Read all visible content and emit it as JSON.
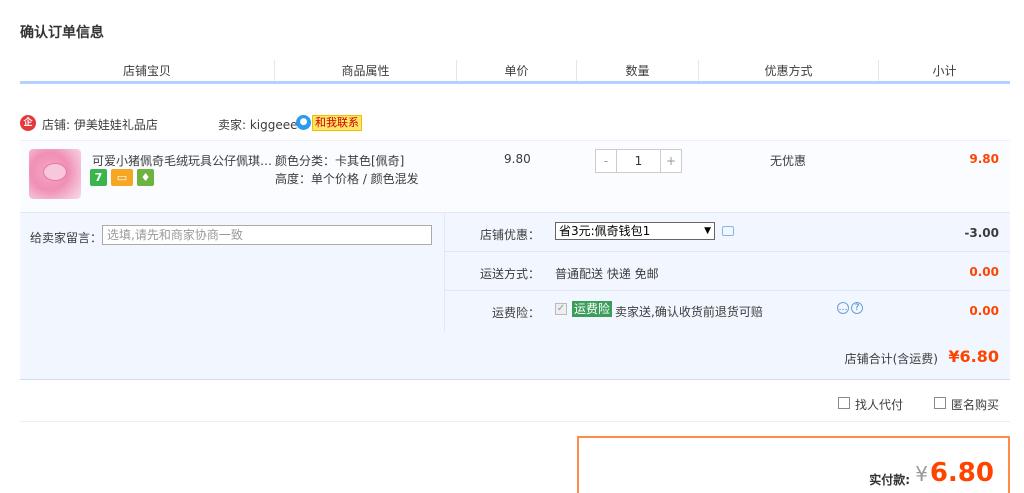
{
  "page": {
    "title": "确认订单信息"
  },
  "columns": [
    "店铺宝贝",
    "商品属性",
    "单价",
    "数量",
    "优惠方式",
    "小计"
  ],
  "shop": {
    "icon": "shop-badge-icon",
    "name": "店铺: 伊美娃娃礼品店",
    "seller": "卖家: kiggeee",
    "contact_label": "和我联系"
  },
  "item": {
    "title": "可爱小猪佩奇毛绒玩具公仔佩琪乔治",
    "badges": [
      {
        "name": "seven-day-return-icon",
        "text": "7"
      },
      {
        "name": "credit-card-icon",
        "text": ""
      },
      {
        "name": "safe-guarantee-icon",
        "text": ""
      }
    ],
    "attr_color": "颜色分类：卡其色[佩奇]",
    "attr_height": "高度：单个价格 / 颜色混发",
    "unit_price": "9.80",
    "qty_minus": "-",
    "quantity": "1",
    "qty_plus": "+",
    "discount": "无优惠",
    "subtotal": "9.80"
  },
  "extras": {
    "message_label": "给卖家留言：",
    "message_placeholder": "选填,请先和商家协商一致",
    "coupon_label": "店铺优惠：",
    "coupon_selected": "省3元:佩奇钱包1",
    "coupon_amount": "-3.00",
    "shipping_label": "运送方式：",
    "shipping_value": "普通配送 快递 免邮",
    "shipping_amount": "0.00",
    "insurance_label": "运费险：",
    "insurance_tag": "运费险",
    "insurance_text": "卖家送,确认收货前退货可赔",
    "insurance_amount": "0.00"
  },
  "totals": {
    "shop_total_label": "店铺合计(含运费)",
    "shop_total": "¥6.80"
  },
  "options": {
    "proxy_pay": "找人代付",
    "anonymous": "匿名购买"
  },
  "payment": {
    "label": "实付款:",
    "currency": "¥",
    "amount": "6.80"
  },
  "colors": {
    "accent": "#ff4400",
    "header_line": "#b2d1ff",
    "panel_bg": "#f2f7ff",
    "pay_border": "#ff8c4b"
  }
}
